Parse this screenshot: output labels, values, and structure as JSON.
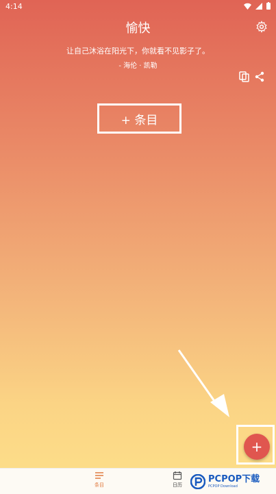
{
  "status_bar": {
    "time": "4:14"
  },
  "header": {
    "title": "愉快"
  },
  "quote": {
    "text": "让自己沐浴在阳光下，你就看不见影子了。",
    "author": "- 海伦 · 凯勒"
  },
  "actions": {
    "add_entry_label": "+ 条目",
    "fab_label": "+"
  },
  "tabs": [
    {
      "label": "条目",
      "icon": "list-icon",
      "active": true
    },
    {
      "label": "日历",
      "icon": "calendar-icon",
      "active": false
    }
  ],
  "watermark": {
    "brand": "PCPOP下载",
    "sub": "PCPOP Download"
  },
  "colors": {
    "gradient_top": "#e06455",
    "gradient_bottom": "#fde08a",
    "fab": "#e0564f",
    "active_tab": "#e07a3f"
  }
}
